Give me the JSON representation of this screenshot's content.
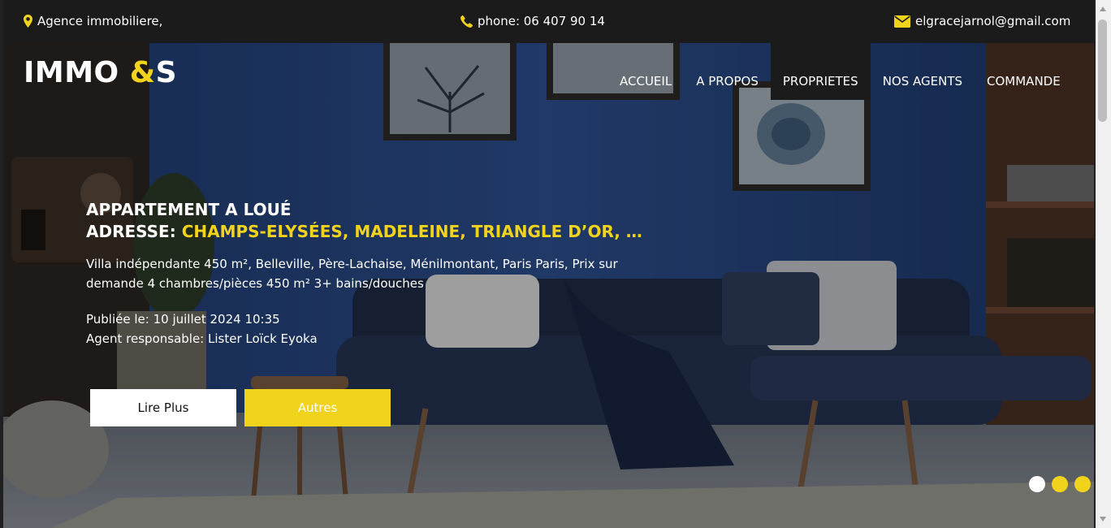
{
  "topbar": {
    "address": "Agence immobiliere,",
    "address_icon": "map-marker-icon",
    "phone": "phone: 06 407 90 14",
    "phone_icon": "phone-icon",
    "email": "elgracejarnol@gmail.com",
    "email_icon": "envelope-icon"
  },
  "brand": {
    "name": "IMMO ",
    "amp": "&",
    "suffix": "S"
  },
  "nav": {
    "items": [
      {
        "label": "ACCUEIL"
      },
      {
        "label": "A PROPOS"
      },
      {
        "label": "PROPRIETES"
      },
      {
        "label": "NOS AGENTS"
      },
      {
        "label": "COMMANDE"
      }
    ],
    "active": "PROPRIETES"
  },
  "hero": {
    "type": "APPARTEMENT A LOUÉ",
    "address_label": "ADRESSE:",
    "address_value": "CHAMPS-ELYSÉES, MADELEINE, TRIANGLE D’OR, …",
    "description": "Villa indépendante 450 m², Belleville, Père-Lachaise, Ménilmontant, Paris Paris, Prix sur demande 4 chambres/pièces 450 m² 3+ bains/douches",
    "published": "Publiée le: 10 juillet 2024 10:35",
    "agent": "Agent responsable: Lister Loïck Eyoka",
    "read_more": "Lire Plus",
    "others": "Autres"
  },
  "slider": {
    "count": 3,
    "active_index": 0
  },
  "colors": {
    "accent": "#f2d31b",
    "topbar": "#1b1b1b",
    "wall": "#2a4a86"
  }
}
